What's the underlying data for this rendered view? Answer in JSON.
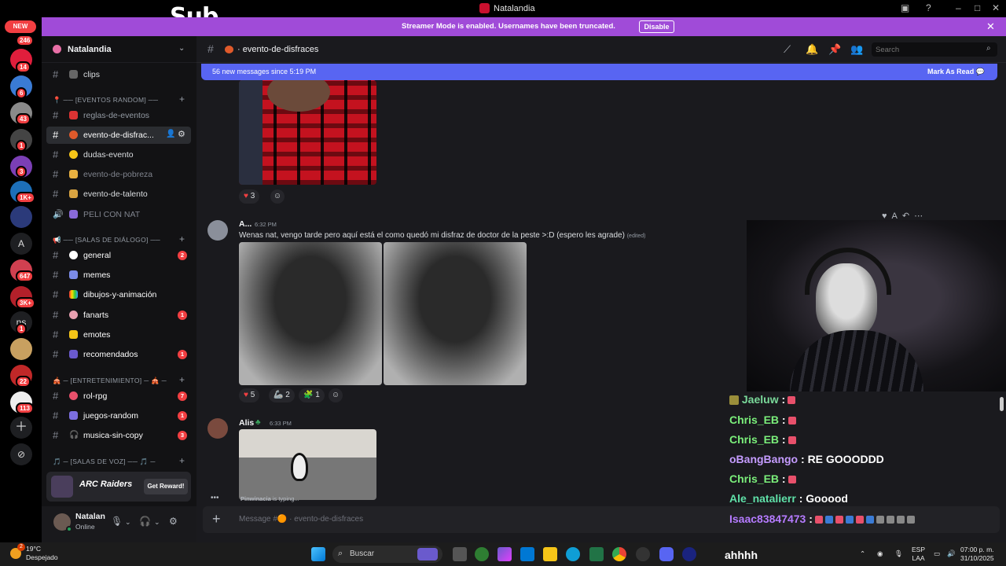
{
  "window": {
    "title": "Natalandia",
    "overlay_logo": "Sub"
  },
  "rail": {
    "new_label": "NEW",
    "badges": [
      "246",
      "14",
      "6",
      "43",
      "1",
      "3",
      "1K+",
      "647",
      "3K+",
      "1",
      "22",
      "113"
    ],
    "letters": [
      "A",
      "ns"
    ]
  },
  "banner": {
    "message": "Streamer Mode is enabled. Usernames have been truncated.",
    "button": "Disable"
  },
  "guild": {
    "name": "Natalandia"
  },
  "sidebar": {
    "channels": [
      {
        "name": "clips"
      },
      {
        "category": "[EVENTOS RANDOM]"
      },
      {
        "name": "reglas-de-eventos"
      },
      {
        "name": "evento-de-disfrac..."
      },
      {
        "name": "dudas-evento"
      },
      {
        "name": "evento-de-pobreza"
      },
      {
        "name": "evento-de-talento"
      },
      {
        "name": "PELI CON NAT"
      },
      {
        "category": "[SALAS DE DIÁLOGO]"
      },
      {
        "name": "general",
        "badge": "2"
      },
      {
        "name": "memes"
      },
      {
        "name": "dibujos-y-animación"
      },
      {
        "name": "fanarts",
        "badge": "1"
      },
      {
        "name": "emotes"
      },
      {
        "name": "recomendados",
        "badge": "1"
      },
      {
        "category": "[ENTRETENIMIENTO]"
      },
      {
        "name": "rol-rpg",
        "badge": "7"
      },
      {
        "name": "juegos-random",
        "badge": "1"
      },
      {
        "name": "musica-sin-copy",
        "badge": "3"
      },
      {
        "category": "[SALAS DE VOZ]"
      }
    ],
    "promo": {
      "brand": "ARC Raiders",
      "button": "Get Reward!"
    },
    "user": {
      "name": "Natalan",
      "status": "Online"
    }
  },
  "header": {
    "channel": "evento-de-disfraces",
    "search_placeholder": "Search"
  },
  "newbar": {
    "text": "56 new messages since 5:19 PM",
    "action": "Mark As Read"
  },
  "messages": [
    {
      "reactions": [
        {
          "emoji": "♥",
          "count": "3"
        }
      ]
    },
    {
      "author": "A...",
      "time": "6:32 PM",
      "text": "Wenas nat, vengo tarde pero aquí está el como quedó mi disfraz de doctor de la peste >:D (espero les agrade)",
      "edited": "(edited)",
      "reactions": [
        {
          "emoji": "♥",
          "count": "5"
        },
        {
          "emoji": "🦾",
          "count": "2"
        },
        {
          "emoji": "🧩",
          "count": "1"
        }
      ]
    },
    {
      "author": "Alis",
      "time": "6:33 PM"
    }
  ],
  "typing": {
    "user": "Pinwinacia",
    "suffix": " is typing..."
  },
  "composer": {
    "placeholder": "Message #🟠 · evento-de-disfraces"
  },
  "stream_chat": [
    {
      "user": "Jaeluw",
      "color": "#7ad99a",
      "text": ""
    },
    {
      "user": "Chris_EB",
      "color": "#7bef7b",
      "text": ""
    },
    {
      "user": "Chris_EB",
      "color": "#7bef7b",
      "text": ""
    },
    {
      "user": "oBangBango",
      "color": "#c59cff",
      "text": "RE GOOODDD"
    },
    {
      "user": "Chris_EB",
      "color": "#7bef7b",
      "text": ""
    },
    {
      "user": "Ale_natalierr",
      "color": "#5fe0a8",
      "text": "Gooood"
    },
    {
      "user": "Isaac83847473",
      "color": "#b57bff",
      "text": ""
    }
  ],
  "stream_bottom": "ahhhh",
  "taskbar": {
    "weather_temp": "19°C",
    "weather_desc": "Despejado",
    "weather_badge": "2",
    "search": "Buscar",
    "lang_top": "ESP",
    "lang_bottom": "LAA",
    "time": "07:00 p. m.",
    "date": "31/10/2025"
  },
  "colors": {
    "blurple": "#5865f2",
    "banner": "#a04bd8",
    "red": "#f23f42"
  }
}
